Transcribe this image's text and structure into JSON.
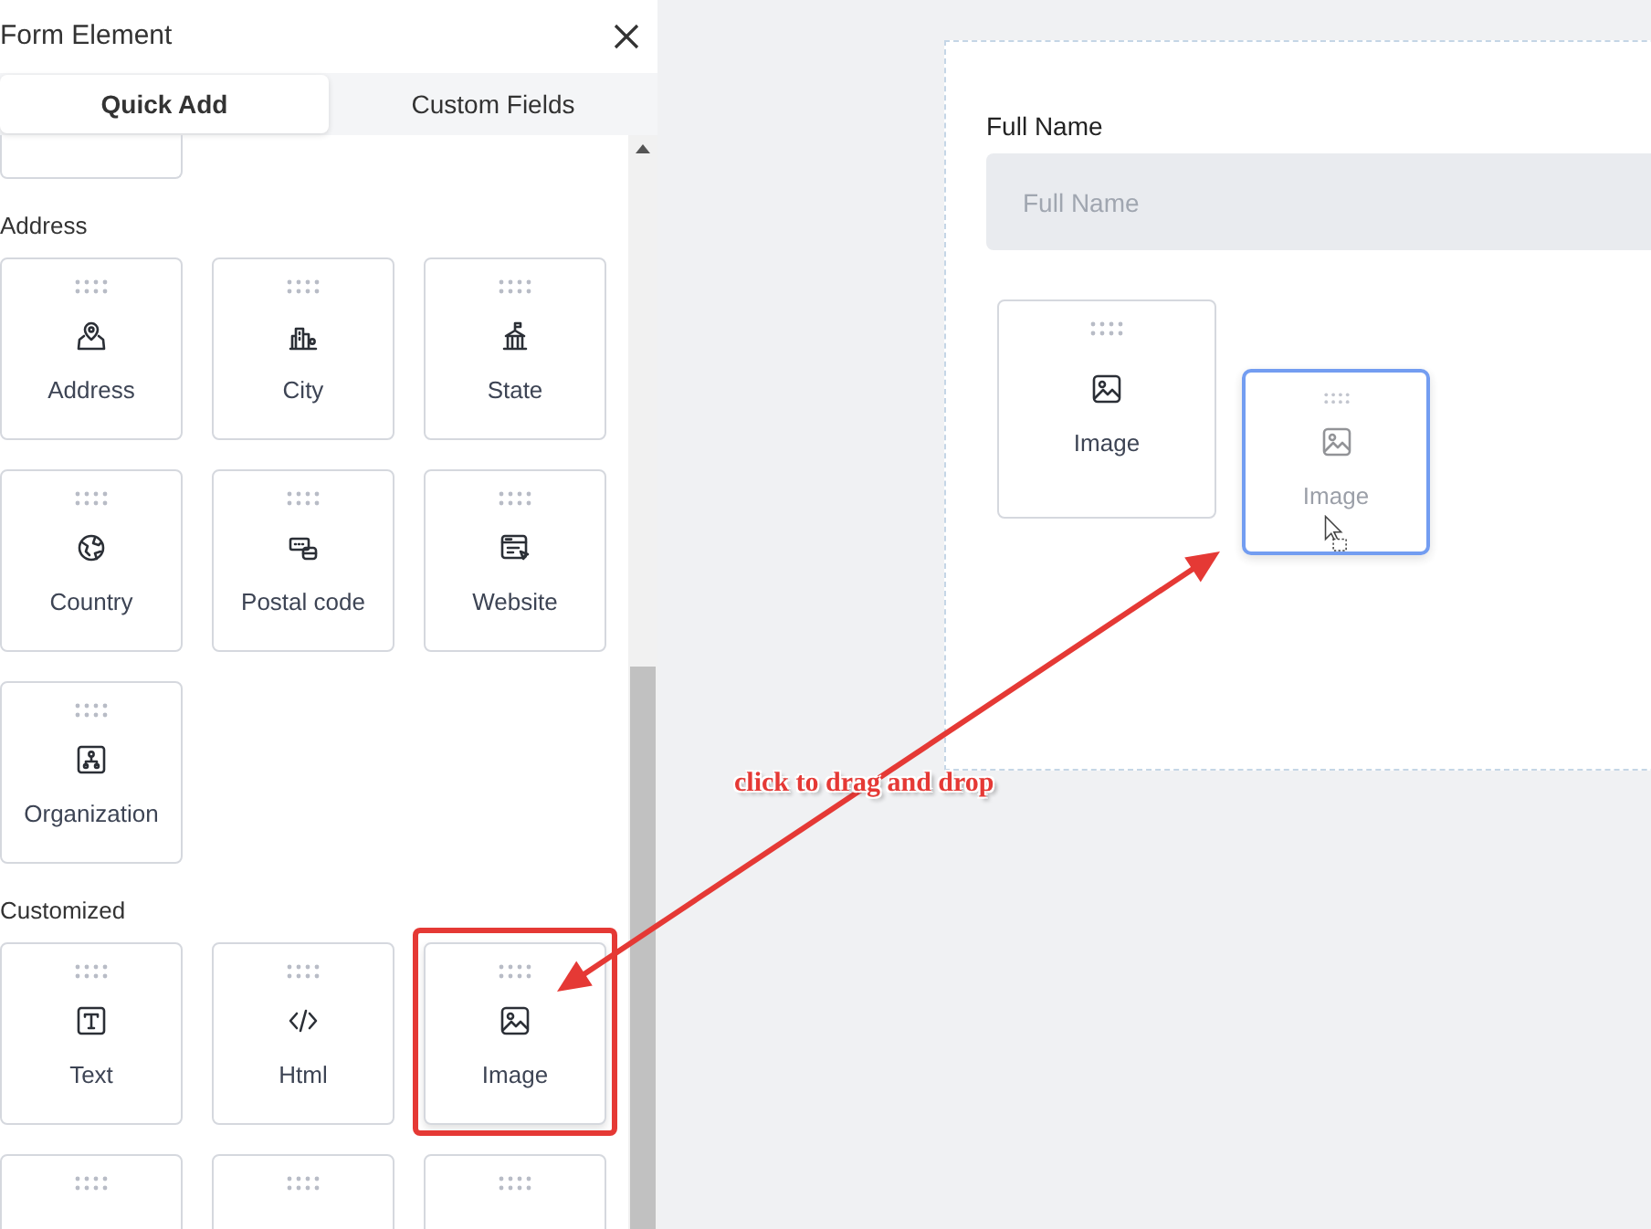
{
  "panel": {
    "title": "Form Element",
    "tabs": [
      {
        "label": "Quick Add",
        "selected": true
      },
      {
        "label": "Custom Fields",
        "selected": false
      }
    ],
    "sections": [
      {
        "title": "Address",
        "items": [
          {
            "label": "Address",
            "highlighted": false
          },
          {
            "label": "City",
            "highlighted": false
          },
          {
            "label": "State",
            "highlighted": false
          },
          {
            "label": "Country",
            "highlighted": false
          },
          {
            "label": "Postal code",
            "highlighted": false
          },
          {
            "label": "Website",
            "highlighted": false
          },
          {
            "label": "Organization",
            "highlighted": false
          }
        ]
      },
      {
        "title": "Customized",
        "items": [
          {
            "label": "Text",
            "highlighted": false
          },
          {
            "label": "Html",
            "highlighted": false
          },
          {
            "label": "Image",
            "highlighted": true
          }
        ]
      }
    ]
  },
  "canvas": {
    "field": {
      "label": "Full Name",
      "placeholder": "Full Name"
    },
    "dropped": [
      {
        "label": "Image",
        "dragging": false
      },
      {
        "label": "Image",
        "dragging": true
      }
    ]
  },
  "annotation": {
    "text": "click to drag and drop"
  }
}
